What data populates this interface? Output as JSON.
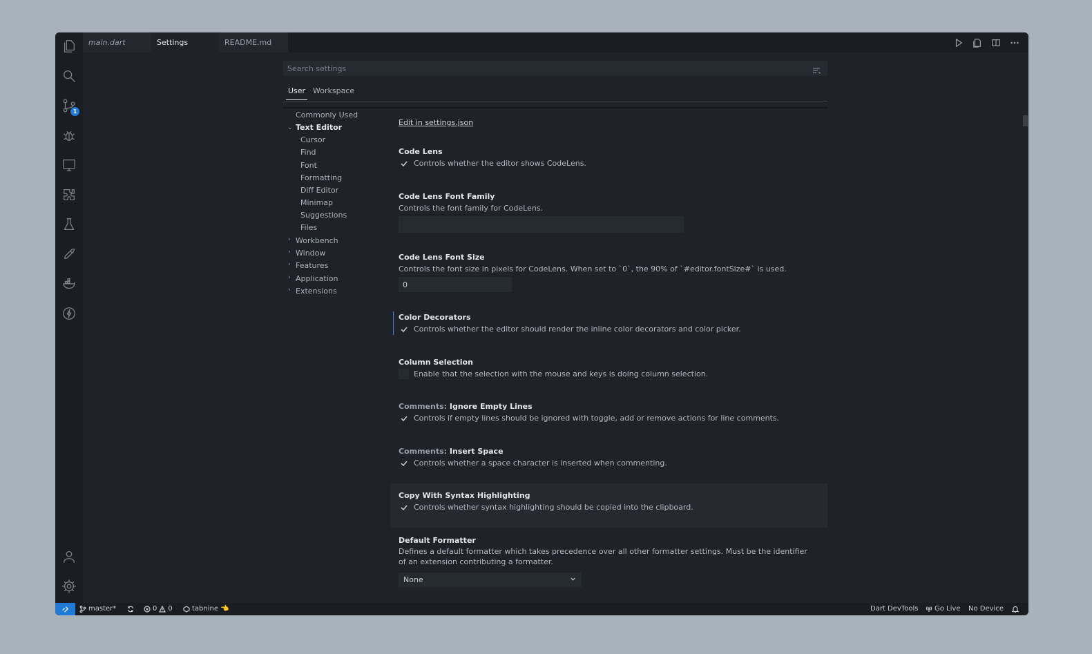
{
  "tabs": [
    {
      "label": "main.dart",
      "style": "preview"
    },
    {
      "label": "Settings",
      "style": "active"
    },
    {
      "label": "README.md",
      "style": "inactive"
    }
  ],
  "tab_actions": [
    "run-icon",
    "open-file-icon",
    "split-editor-icon",
    "more-icon"
  ],
  "activity_bar": {
    "top": [
      "explorer-icon",
      "search-icon",
      "source-control-icon",
      "debug-icon",
      "remote-explorer-icon",
      "extensions-icon",
      "testing-icon",
      "rocket-icon",
      "docker-icon",
      "lightning-icon"
    ],
    "bottom": [
      "account-icon",
      "manage-gear-icon"
    ],
    "source_control_badge": "1"
  },
  "search": {
    "placeholder": "Search settings"
  },
  "scope_tabs": {
    "user": "User",
    "workspace": "Workspace"
  },
  "toc": {
    "commonly_used": "Commonly Used",
    "text_editor": "Text Editor",
    "children": [
      "Cursor",
      "Find",
      "Font",
      "Formatting",
      "Diff Editor",
      "Minimap",
      "Suggestions",
      "Files"
    ],
    "collapsed": [
      "Workbench",
      "Window",
      "Features",
      "Application",
      "Extensions"
    ]
  },
  "settings": {
    "edit_link": "Edit in settings.json",
    "code_lens": {
      "title": "Code Lens",
      "desc": "Controls whether the editor shows CodeLens.",
      "checked": true
    },
    "code_lens_font_family": {
      "title": "Code Lens Font Family",
      "desc": "Controls the font family for CodeLens.",
      "value": ""
    },
    "code_lens_font_size": {
      "title": "Code Lens Font Size",
      "desc": "Controls the font size in pixels for CodeLens. When set to `0`, the 90% of `#editor.fontSize#` is used.",
      "value": "0"
    },
    "color_decorators": {
      "title": "Color Decorators",
      "desc": "Controls whether the editor should render the inline color decorators and color picker.",
      "checked": true
    },
    "column_selection": {
      "title": "Column Selection",
      "desc": "Enable that the selection with the mouse and keys is doing column selection.",
      "checked": false
    },
    "comments_ignore": {
      "category": "Comments: ",
      "title": "Ignore Empty Lines",
      "desc": "Controls if empty lines should be ignored with toggle, add or remove actions for line comments.",
      "checked": true
    },
    "comments_insert": {
      "category": "Comments: ",
      "title": "Insert Space",
      "desc": "Controls whether a space character is inserted when commenting.",
      "checked": true
    },
    "copy_syntax": {
      "title": "Copy With Syntax Highlighting",
      "desc": "Controls whether syntax highlighting should be copied into the clipboard.",
      "checked": true
    },
    "default_formatter": {
      "title": "Default Formatter",
      "desc": "Defines a default formatter which takes precedence over all other formatter settings. Must be the identifier of an extension contributing a formatter.",
      "value": "None"
    }
  },
  "statusbar": {
    "branch": "master*",
    "errors": "0",
    "warnings": "0",
    "tabnine": "tabnine",
    "tabnine_emoji": "👈",
    "dart_devtools": "Dart DevTools",
    "go_live": "Go Live",
    "no_device": "No Device"
  },
  "colors": {
    "accent": "#1f7ad8",
    "background": "#1f2228",
    "page_bg": "#a7b2bd"
  }
}
